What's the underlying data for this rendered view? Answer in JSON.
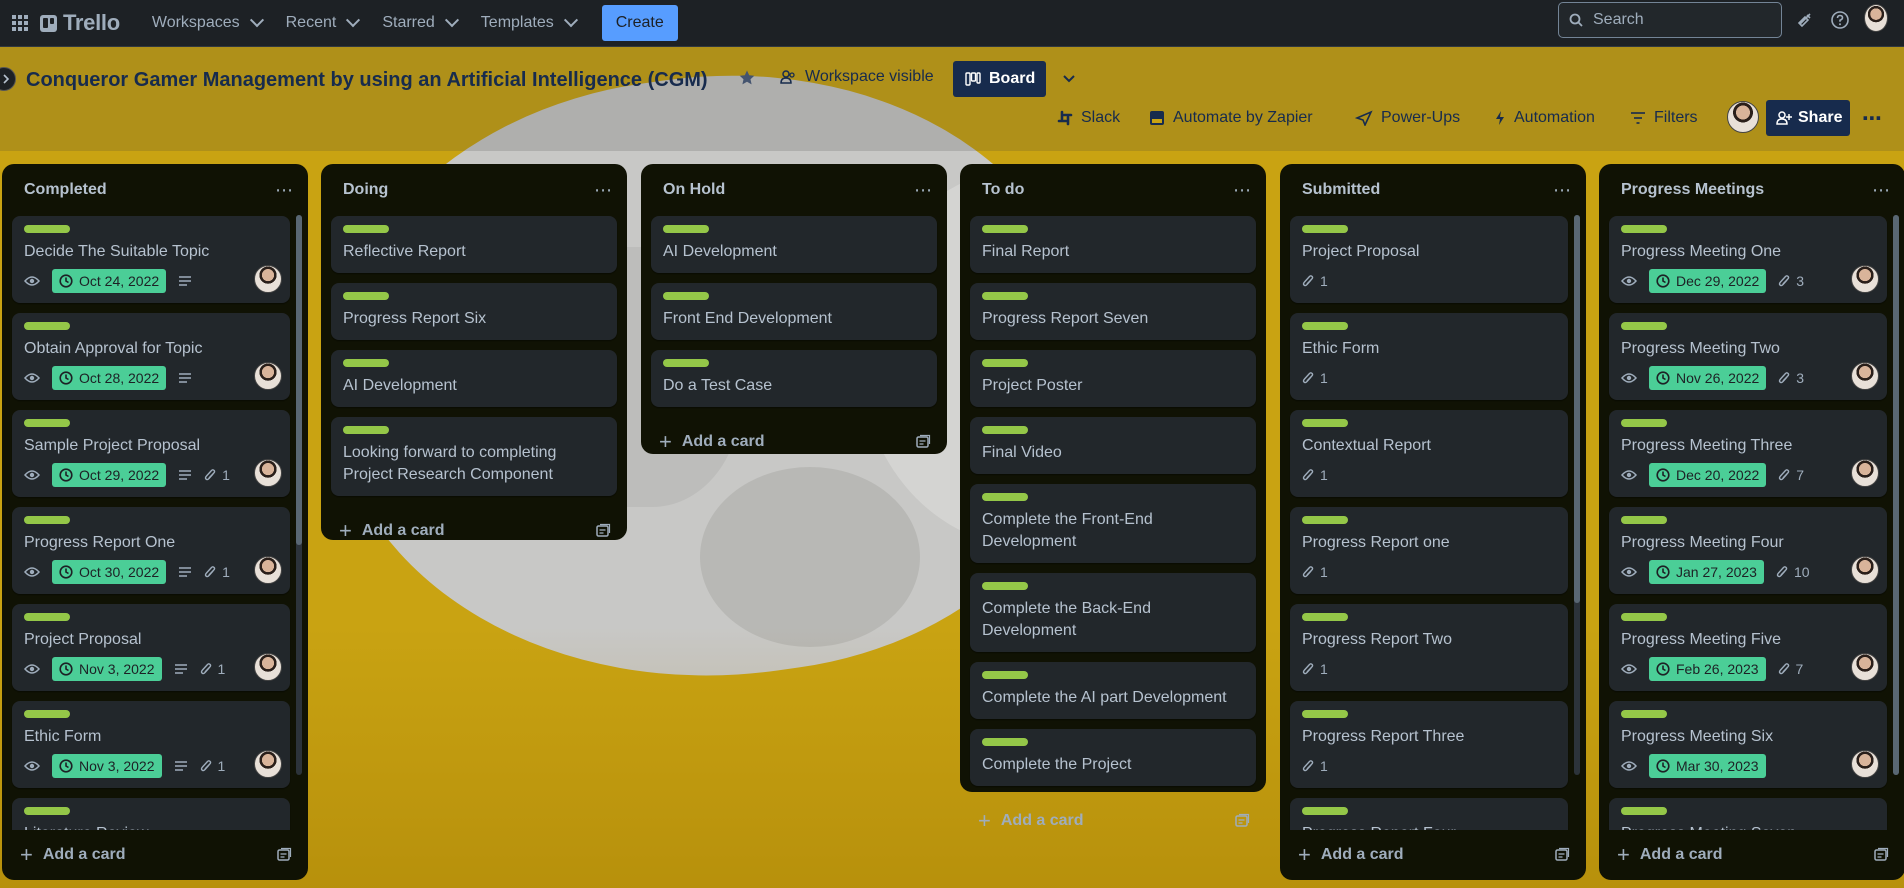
{
  "nav": {
    "logo": "Trello",
    "items": [
      {
        "label": "Workspaces"
      },
      {
        "label": "Recent"
      },
      {
        "label": "Starred"
      },
      {
        "label": "Templates"
      }
    ],
    "create": "Create",
    "search_placeholder": "Search"
  },
  "board": {
    "title": "Conqueror Gamer Management by using an Artificial Intelligence (CGM)",
    "visibility": "Workspace visible",
    "view": "Board",
    "toolbar": {
      "slack": "Slack",
      "zapier": "Automate by Zapier",
      "powerups": "Power-Ups",
      "automation": "Automation",
      "filters": "Filters",
      "share": "Share"
    },
    "add_card": "Add a card"
  },
  "colors": {
    "label_green": "#94c748",
    "due_green": "#4bce97",
    "list_bg": "#101204",
    "card_bg": "#22272b",
    "board_bg": "#c9a312"
  },
  "lists": [
    {
      "title": "Completed",
      "cards": [
        {
          "title": "Decide The Suitable Topic",
          "due": "Oct 24, 2022",
          "desc": true,
          "watch": true,
          "avatar": true
        },
        {
          "title": "Obtain Approval for Topic",
          "due": "Oct 28, 2022",
          "desc": true,
          "watch": true,
          "avatar": true
        },
        {
          "title": "Sample Project Proposal",
          "due": "Oct 29, 2022",
          "desc": true,
          "attach": "1",
          "watch": true,
          "avatar": true
        },
        {
          "title": "Progress Report One",
          "due": "Oct 30, 2022",
          "desc": true,
          "attach": "1",
          "watch": true,
          "avatar": true
        },
        {
          "title": "Project Proposal",
          "due": "Nov 3, 2022",
          "desc": true,
          "attach": "1",
          "watch": true,
          "avatar": true
        },
        {
          "title": "Ethic Form",
          "due": "Nov 3, 2022",
          "desc": true,
          "attach": "1",
          "watch": true,
          "avatar": true
        },
        {
          "title": "Literature Review"
        }
      ]
    },
    {
      "title": "Doing",
      "cards": [
        {
          "title": "Reflective Report"
        },
        {
          "title": "Progress Report Six"
        },
        {
          "title": "AI Development"
        },
        {
          "title": "Looking forward to completing Project Research Component"
        }
      ]
    },
    {
      "title": "On Hold",
      "cards": [
        {
          "title": "AI Development"
        },
        {
          "title": "Front End Development"
        },
        {
          "title": "Do a Test Case"
        }
      ]
    },
    {
      "title": "To do",
      "cards": [
        {
          "title": "Final Report"
        },
        {
          "title": "Progress Report Seven"
        },
        {
          "title": "Project Poster"
        },
        {
          "title": "Final Video"
        },
        {
          "title": "Complete the Front-End Development"
        },
        {
          "title": "Complete the Back-End Development"
        },
        {
          "title": "Complete the AI part Development"
        },
        {
          "title": "Complete the Project"
        }
      ]
    },
    {
      "title": "Submitted",
      "cards": [
        {
          "title": "Project Proposal",
          "attach": "1"
        },
        {
          "title": "Ethic Form",
          "attach": "1"
        },
        {
          "title": "Contextual Report",
          "attach": "1"
        },
        {
          "title": "Progress Report one",
          "attach": "1"
        },
        {
          "title": "Progress Report Two",
          "attach": "1"
        },
        {
          "title": "Progress Report Three",
          "attach": "1"
        },
        {
          "title": "Progress Report Four"
        }
      ]
    },
    {
      "title": "Progress Meetings",
      "cards": [
        {
          "title": "Progress Meeting One",
          "due": "Dec 29, 2022",
          "attach": "3",
          "watch": true,
          "avatar": true
        },
        {
          "title": "Progress Meeting Two",
          "due": "Nov 26, 2022",
          "attach": "3",
          "watch": true,
          "avatar": true
        },
        {
          "title": "Progress Meeting Three",
          "due": "Dec 20, 2022",
          "attach": "7",
          "watch": true,
          "avatar": true
        },
        {
          "title": "Progress Meeting Four",
          "due": "Jan 27, 2023",
          "attach": "10",
          "watch": true,
          "avatar": true
        },
        {
          "title": "Progress Meeting Five",
          "due": "Feb 26, 2023",
          "attach": "7",
          "watch": true,
          "avatar": true
        },
        {
          "title": "Progress Meeting Six",
          "due": "Mar 30, 2023",
          "watch": true,
          "avatar": true
        },
        {
          "title": "Progress Meeting Seven"
        }
      ]
    }
  ]
}
